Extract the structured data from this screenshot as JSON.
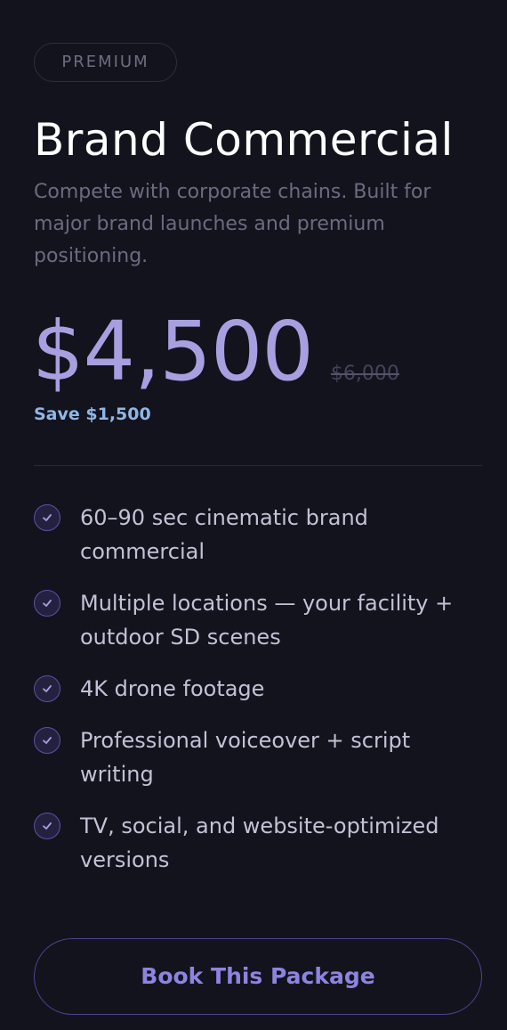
{
  "package": {
    "badge": "PREMIUM",
    "title": "Brand Commercial",
    "subtitle": "Compete with corporate chains. Built for major brand launches and premium positioning.",
    "price": "$4,500",
    "original_price": "$6,000",
    "savings": "Save $1,500",
    "features": [
      "60–90 sec cinematic brand commercial",
      "Multiple locations — your facility + outdoor SD scenes",
      "4K drone footage",
      "Professional voiceover + script writing",
      "TV, social, and website-optimized versions"
    ],
    "cta_label": "Book This Package"
  },
  "icons": {
    "feature_icon": "check-circle-icon"
  },
  "colors": {
    "background": "#13131d",
    "accent": "#a7a0e0",
    "savings": "#8fb6e8",
    "cta_text": "#8d84e0"
  }
}
